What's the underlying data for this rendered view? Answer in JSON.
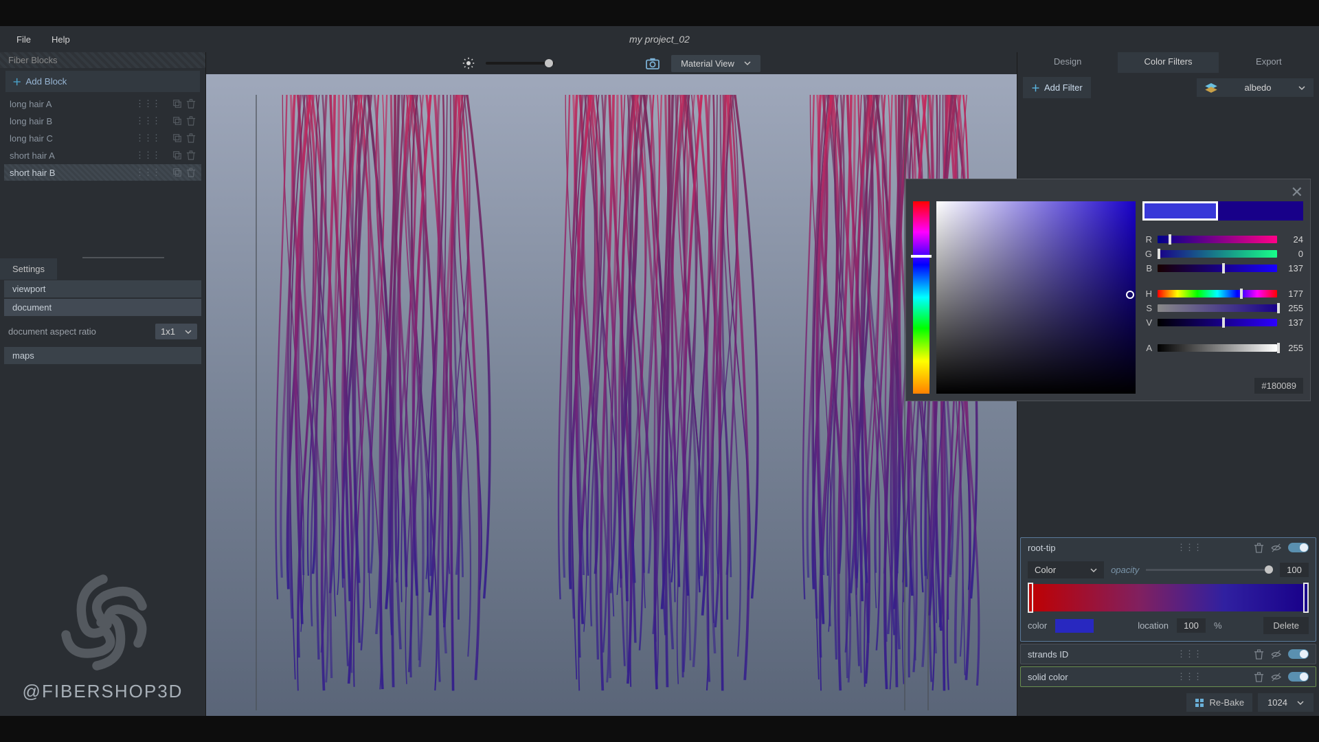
{
  "menu": {
    "file": "File",
    "help": "Help"
  },
  "title": "my project_02",
  "sidebar": {
    "header": "Fiber Blocks",
    "add_block": "Add Block",
    "items": [
      {
        "name": "long hair A",
        "selected": false
      },
      {
        "name": "long hair B",
        "selected": false
      },
      {
        "name": "long hair C",
        "selected": false
      },
      {
        "name": "short hair A",
        "selected": false
      },
      {
        "name": "short hair B",
        "selected": true
      }
    ]
  },
  "settings": {
    "tab": "Settings",
    "viewport": "viewport",
    "document": "document",
    "aspect_label": "document aspect ratio",
    "aspect_value": "1x1",
    "maps": "maps"
  },
  "logo_text": "@FIBERSHOP3D",
  "viewport_toolbar": {
    "view_mode": "Material View"
  },
  "right_tabs": {
    "design": "Design",
    "color_filters": "Color Filters",
    "export": "Export"
  },
  "filter_bar": {
    "add_filter": "Add Filter",
    "channel": "albedo"
  },
  "color_picker": {
    "r": {
      "label": "R",
      "value": 24
    },
    "g": {
      "label": "G",
      "value": 0
    },
    "b": {
      "label": "B",
      "value": 137
    },
    "h": {
      "label": "H",
      "value": 177
    },
    "s": {
      "label": "S",
      "value": 255
    },
    "v": {
      "label": "V",
      "value": 137
    },
    "a": {
      "label": "A",
      "value": 255
    },
    "hex": "#180089"
  },
  "filters": {
    "root_tip": {
      "title": "root-tip",
      "mode": "Color",
      "opacity_label": "opacity",
      "opacity_value": 100,
      "color_label": "color",
      "location_label": "location",
      "location_value": 100,
      "location_unit": "%",
      "delete": "Delete"
    },
    "strands_id": {
      "title": "strands ID"
    },
    "solid_color": {
      "title": "solid color"
    }
  },
  "bake": {
    "rebake": "Re-Bake",
    "resolution": "1024"
  }
}
